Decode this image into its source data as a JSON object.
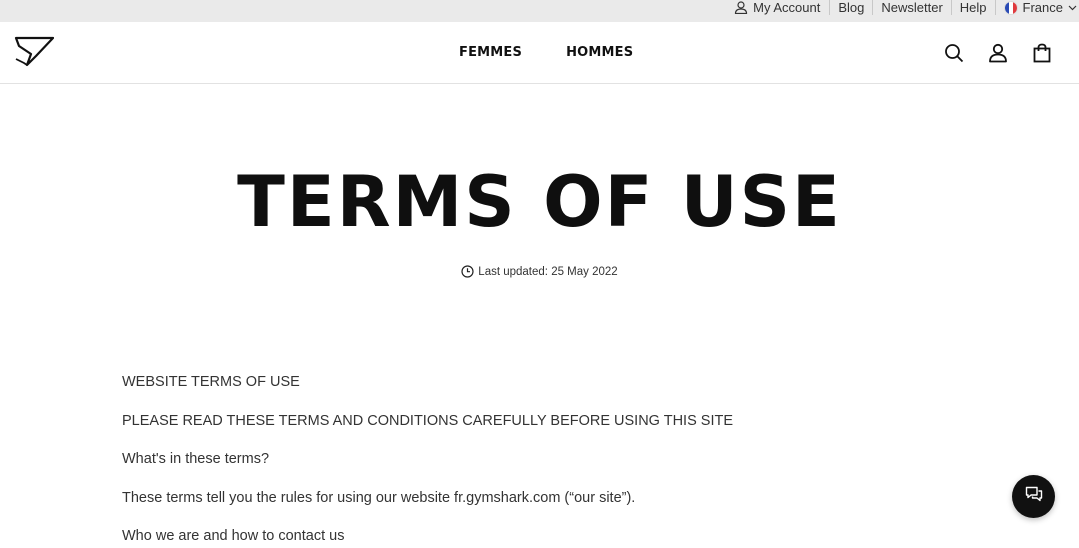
{
  "utility": {
    "account_label": "My Account",
    "blog_label": "Blog",
    "newsletter_label": "Newsletter",
    "help_label": "Help",
    "country_label": "France"
  },
  "nav": {
    "women_label": "FEMMES",
    "men_label": "HOMMES"
  },
  "page": {
    "title": "TERMS OF USE",
    "last_updated": "Last updated: 25 May 2022"
  },
  "content": {
    "paragraphs": [
      "WEBSITE TERMS OF USE",
      "PLEASE READ THESE TERMS AND CONDITIONS CAREFULLY BEFORE USING THIS SITE",
      "What's in these terms?",
      "These terms tell you the rules for using our website fr.gymshark.com (“our site”).",
      "Who we are and how to contact us"
    ]
  },
  "icons": {
    "account": "user-icon",
    "flag": "france-flag-icon",
    "search": "search-icon",
    "profile": "user-icon",
    "bag": "shopping-bag-icon",
    "clock": "clock-icon",
    "chat": "chat-icon"
  },
  "colors": {
    "utility_bg": "#eaeaea",
    "text_dark": "#0f0f0f",
    "chat_bg": "#111111",
    "flag_blue": "#2a4bb5",
    "flag_red": "#e03a3e"
  }
}
